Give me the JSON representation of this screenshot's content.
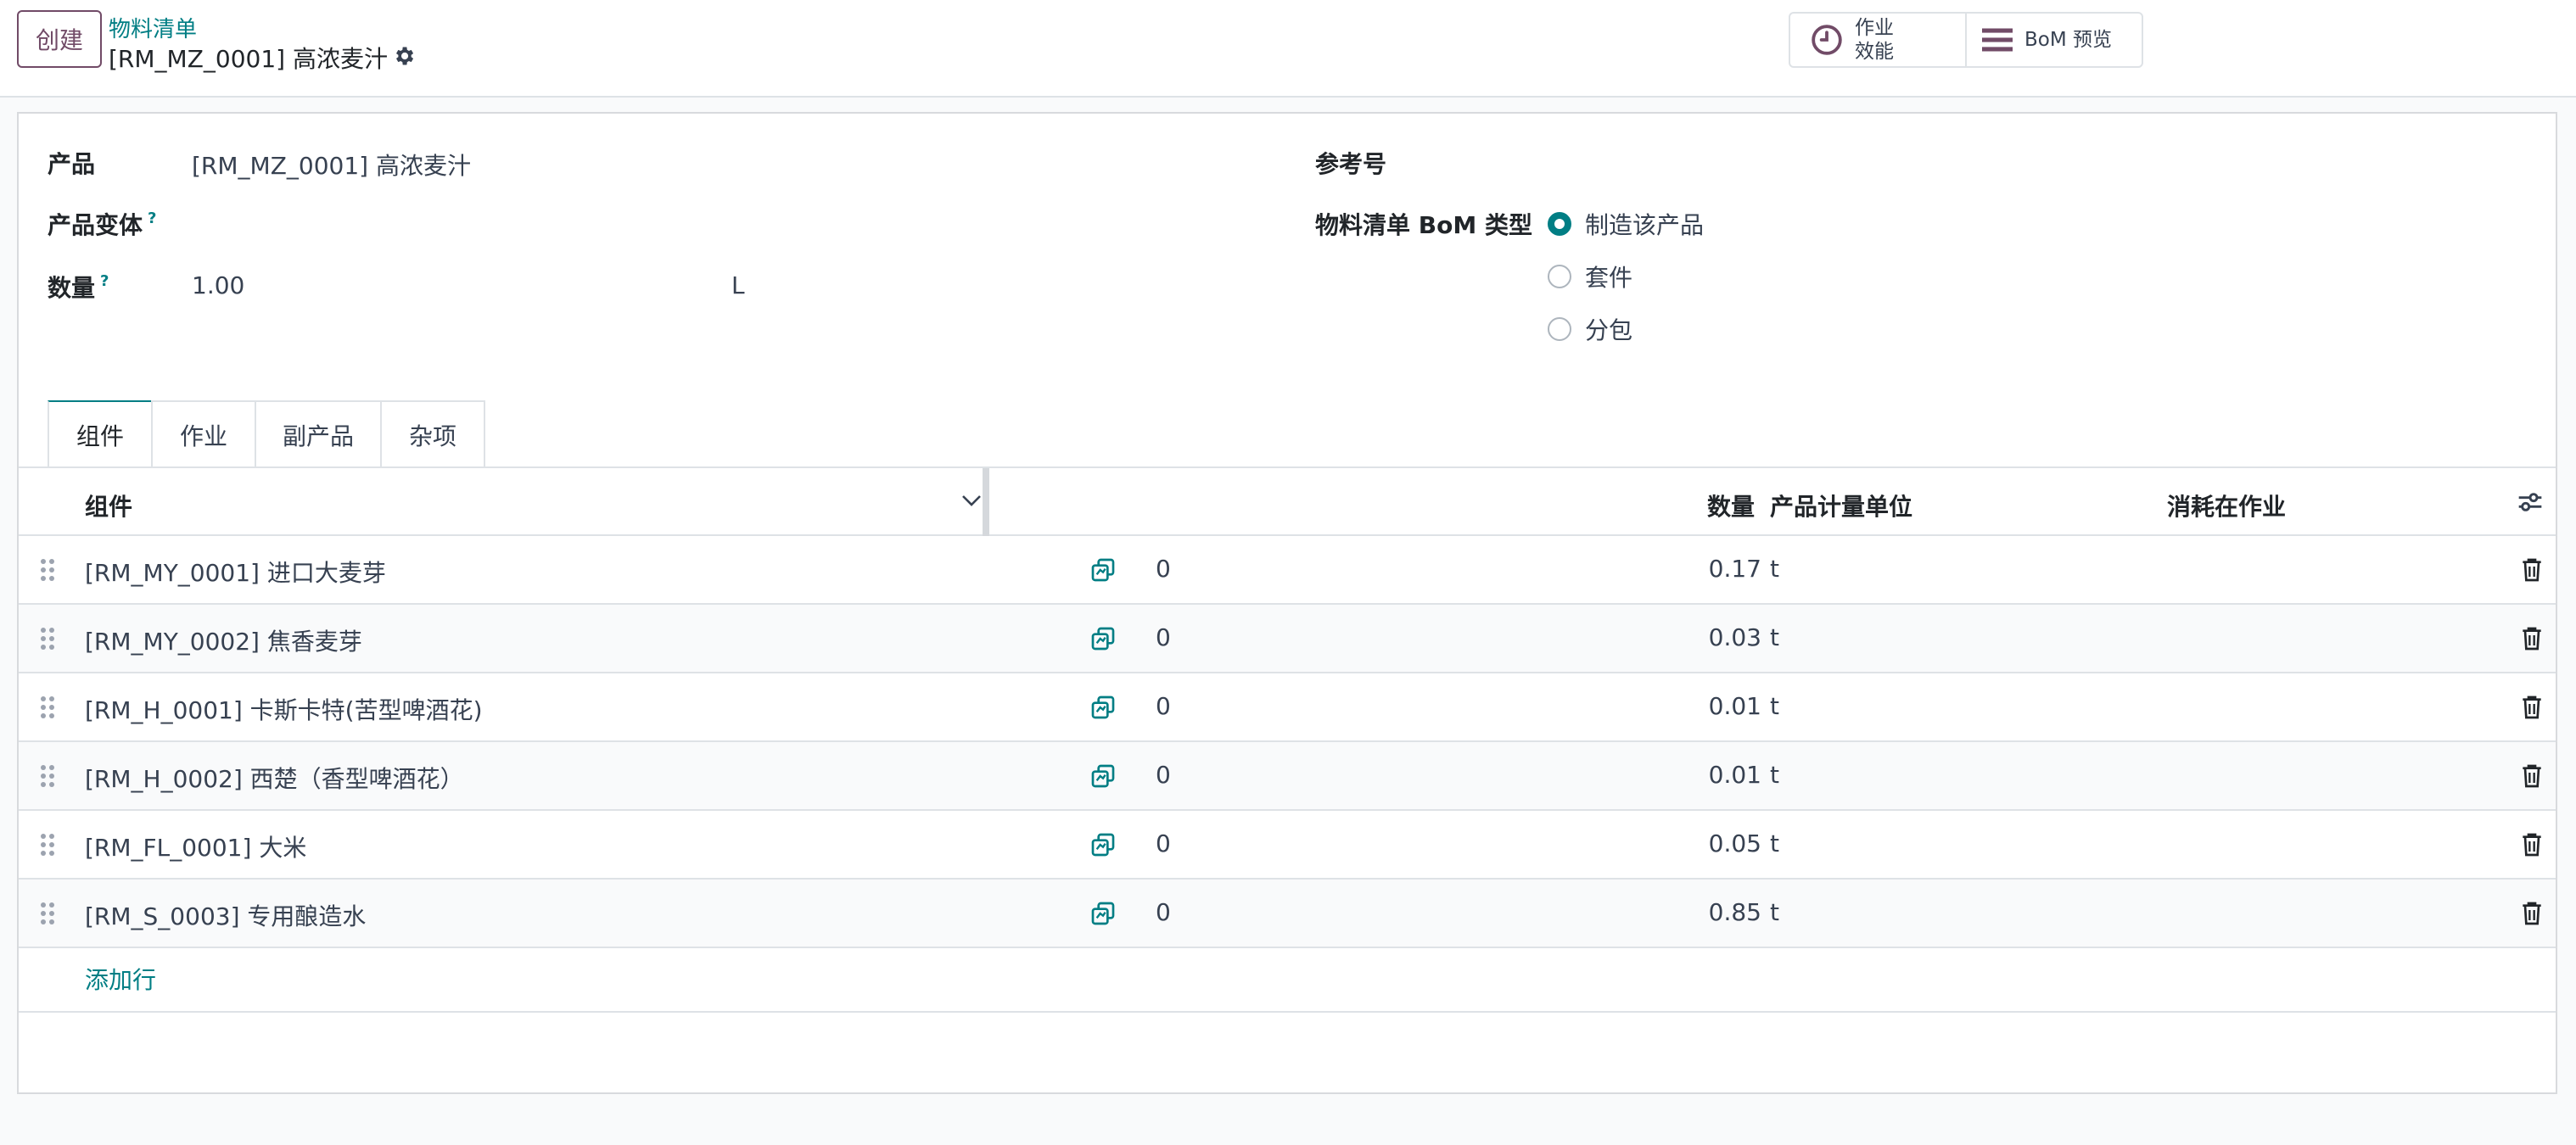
{
  "control_panel": {
    "create_label": "创建",
    "breadcrumb": "物料清单",
    "record_title": "[RM_MZ_0001] 高浓麦汁",
    "stat_operations_line1": "作业",
    "stat_operations_line2": "效能",
    "stat_bom_preview": "BoM 预览"
  },
  "form": {
    "product_label": "产品",
    "product_value": "[RM_MZ_0001] 高浓麦汁",
    "variant_label": "产品变体",
    "quantity_label": "数量",
    "quantity_value": "1.00",
    "uom_value": "L",
    "reference_label": "参考号",
    "bom_type_label": "物料清单 BoM 类型",
    "help_mark": "?",
    "bom_type_options": [
      {
        "label": "制造该产品",
        "checked": true
      },
      {
        "label": "套件",
        "checked": false
      },
      {
        "label": "分包",
        "checked": false
      }
    ]
  },
  "tabs": [
    {
      "label": "组件",
      "active": true
    },
    {
      "label": "作业",
      "active": false
    },
    {
      "label": "副产品",
      "active": false
    },
    {
      "label": "杂项",
      "active": false
    }
  ],
  "table": {
    "headers": {
      "component": "组件",
      "quantity": "数量",
      "uom": "产品计量单位",
      "consumed_in": "消耗在作业"
    },
    "rows": [
      {
        "component": "[RM_MY_0001] 进口大麦芽",
        "avail": "0",
        "quantity": "0.17",
        "uom": "t"
      },
      {
        "component": "[RM_MY_0002] 焦香麦芽",
        "avail": "0",
        "quantity": "0.03",
        "uom": "t"
      },
      {
        "component": "[RM_H_0001] 卡斯卡特(苦型啤酒花)",
        "avail": "0",
        "quantity": "0.01",
        "uom": "t"
      },
      {
        "component": "[RM_H_0002] 西楚（香型啤酒花）",
        "avail": "0",
        "quantity": "0.01",
        "uom": "t"
      },
      {
        "component": "[RM_FL_0001] 大米",
        "avail": "0",
        "quantity": "0.05",
        "uom": "t"
      },
      {
        "component": "[RM_S_0003] 专用酿造水",
        "avail": "0",
        "quantity": "0.85",
        "uom": "t"
      }
    ],
    "add_line_label": "添加行"
  },
  "colors": {
    "primary": "#714b67",
    "accent": "#017e84",
    "border": "#dee2e6"
  }
}
